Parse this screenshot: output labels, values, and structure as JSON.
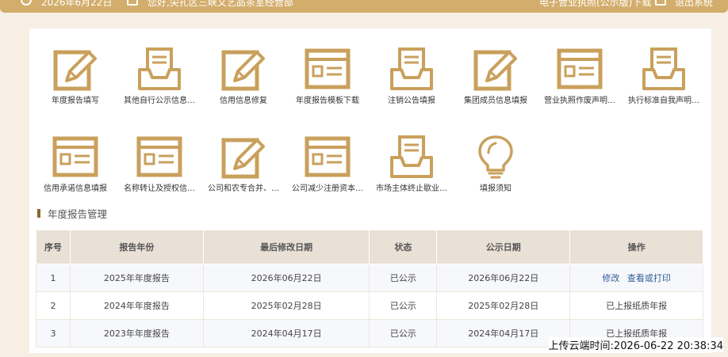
{
  "header": {
    "date": "2026年6月22日",
    "welcome": "您好,尖扎区三峡文艺品茶室经营部",
    "download": "电子营业执照(公示版)下载",
    "logout": "退出系统"
  },
  "tiles": [
    {
      "label": "年度报告填写",
      "icon": "pencil-doc-icon"
    },
    {
      "label": "其他自行公示信息…",
      "icon": "tray-doc-icon"
    },
    {
      "label": "信用信息修复",
      "icon": "pencil-doc-icon"
    },
    {
      "label": "年度报告模板下载",
      "icon": "form-doc-icon"
    },
    {
      "label": "注销公告填报",
      "icon": "tray-doc-icon"
    },
    {
      "label": "集团成员信息填报",
      "icon": "pencil-doc-icon"
    },
    {
      "label": "营业执照作废声明…",
      "icon": "form-doc-icon"
    },
    {
      "label": "执行标准自我声明…",
      "icon": "tray-doc-icon"
    },
    {
      "label": "信用承诺信息填报",
      "icon": "form-doc-icon"
    },
    {
      "label": "名称转让及授权信…",
      "icon": "form-doc-icon"
    },
    {
      "label": "公司和农专合并、…",
      "icon": "pencil-doc-icon"
    },
    {
      "label": "公司减少注册资本…",
      "icon": "form-doc-icon"
    },
    {
      "label": "市场主体终止歇业…",
      "icon": "tray-doc-icon"
    },
    {
      "label": "填报须知",
      "icon": "lightbulb-icon"
    }
  ],
  "section": {
    "title": "年度报告管理"
  },
  "table": {
    "headers": [
      "序号",
      "报告年份",
      "最后修改日期",
      "状态",
      "公示日期",
      "操作"
    ],
    "rows": [
      {
        "no": "1",
        "year": "2025年年度报告",
        "modified": "2026年06月22日",
        "status": "已公示",
        "published": "2026年06月22日",
        "action1": "修改",
        "action2": "查看或打印"
      },
      {
        "no": "2",
        "year": "2024年年度报告",
        "modified": "2025年02月28日",
        "status": "已公示",
        "published": "2025年02月28日",
        "action_text": "已上报纸质年报"
      },
      {
        "no": "3",
        "year": "2023年年度报告",
        "modified": "2024年04月17日",
        "status": "已公示",
        "published": "2024年04月17日",
        "action_text": "已上报纸质年报"
      }
    ]
  },
  "upload_time": "上传云端时间:2026-06-22 20:38:34",
  "colors": {
    "gold": "#d3ad6b",
    "link": "#2f5c9a",
    "header_bg": "#e9e0d6"
  }
}
